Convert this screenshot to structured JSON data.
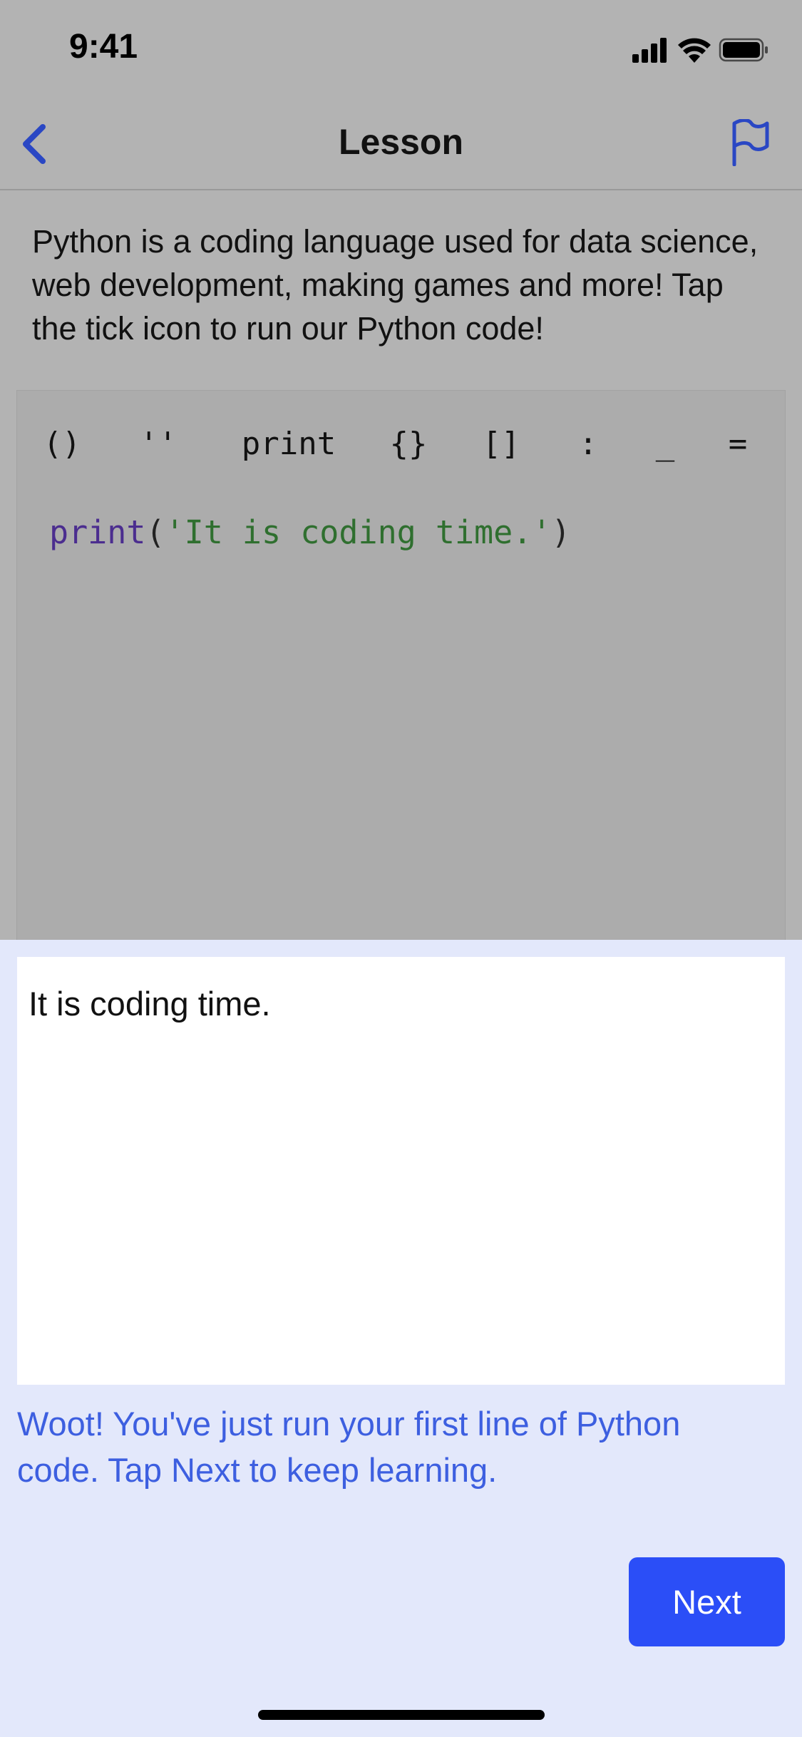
{
  "status_bar": {
    "time": "9:41",
    "icons": [
      "signal-icon",
      "wifi-icon",
      "battery-icon"
    ]
  },
  "nav": {
    "title": "Lesson",
    "back_icon": "chevron-left-icon",
    "flag_icon": "flag-icon"
  },
  "instruction": "Python is a coding language used for data science, web development, making games and more! Tap the tick icon to run our Python code!",
  "editor": {
    "symbol_keys": [
      "()",
      "''",
      "print",
      "{}",
      "[]",
      ":",
      "_",
      "="
    ],
    "code": {
      "keyword": "print",
      "open_paren": "(",
      "string": "'It is coding time.'",
      "close_paren": ")"
    }
  },
  "output": {
    "text": "It is coding time."
  },
  "feedback": "Woot! You've just run your first line of Python code. Tap Next to keep learning.",
  "next_button": "Next",
  "colors": {
    "accent": "#2b4ef7",
    "feedback_text": "#3d5fe0",
    "sheet_background": "#e3e8fb",
    "dimmed_background": "#b3b3b3",
    "keyword": "#4b2d8f",
    "string": "#2f6f2f"
  }
}
